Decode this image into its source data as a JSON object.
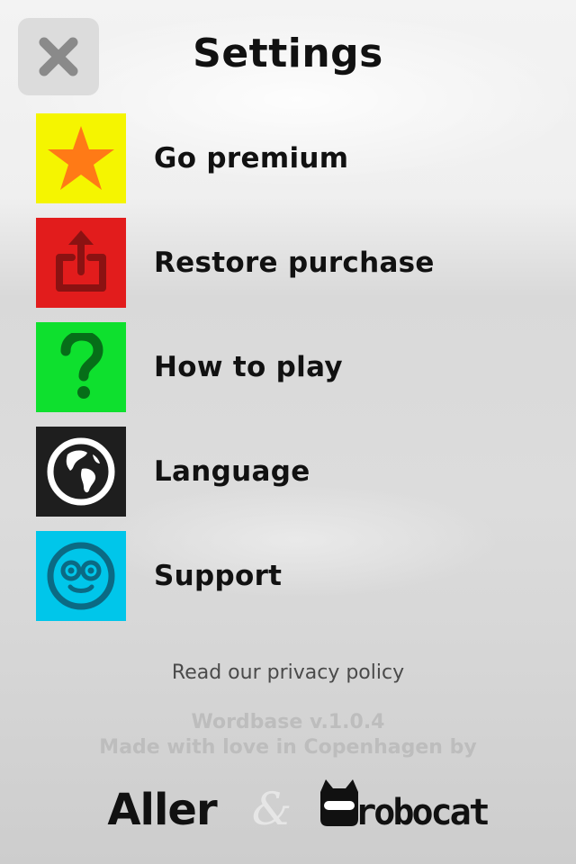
{
  "header": {
    "title": "Settings"
  },
  "menu": {
    "items": [
      {
        "label": "Go premium",
        "icon": "star-icon",
        "color": "#f5f500"
      },
      {
        "label": "Restore purchase",
        "icon": "share-icon",
        "color": "#e21c1c"
      },
      {
        "label": "How to play",
        "icon": "question-icon",
        "color": "#0ee02e"
      },
      {
        "label": "Language",
        "icon": "globe-icon",
        "color": "#1e1e1e"
      },
      {
        "label": "Support",
        "icon": "smiley-glasses-icon",
        "color": "#00c6ea"
      }
    ]
  },
  "footer": {
    "privacy_link": "Read our privacy policy",
    "version": "Wordbase v.1.0.4",
    "made_with": "Made with love in Copenhagen by",
    "brand_aller": "Aller",
    "ampersand": "&",
    "brand_robocat": "robocat"
  },
  "colors": {
    "star_fill": "#ff7a16",
    "icon_red_dark": "#8b1212",
    "icon_green_dark": "#066e18",
    "icon_blue_dark": "#0b6a84",
    "close_x": "#8a8a8a"
  }
}
